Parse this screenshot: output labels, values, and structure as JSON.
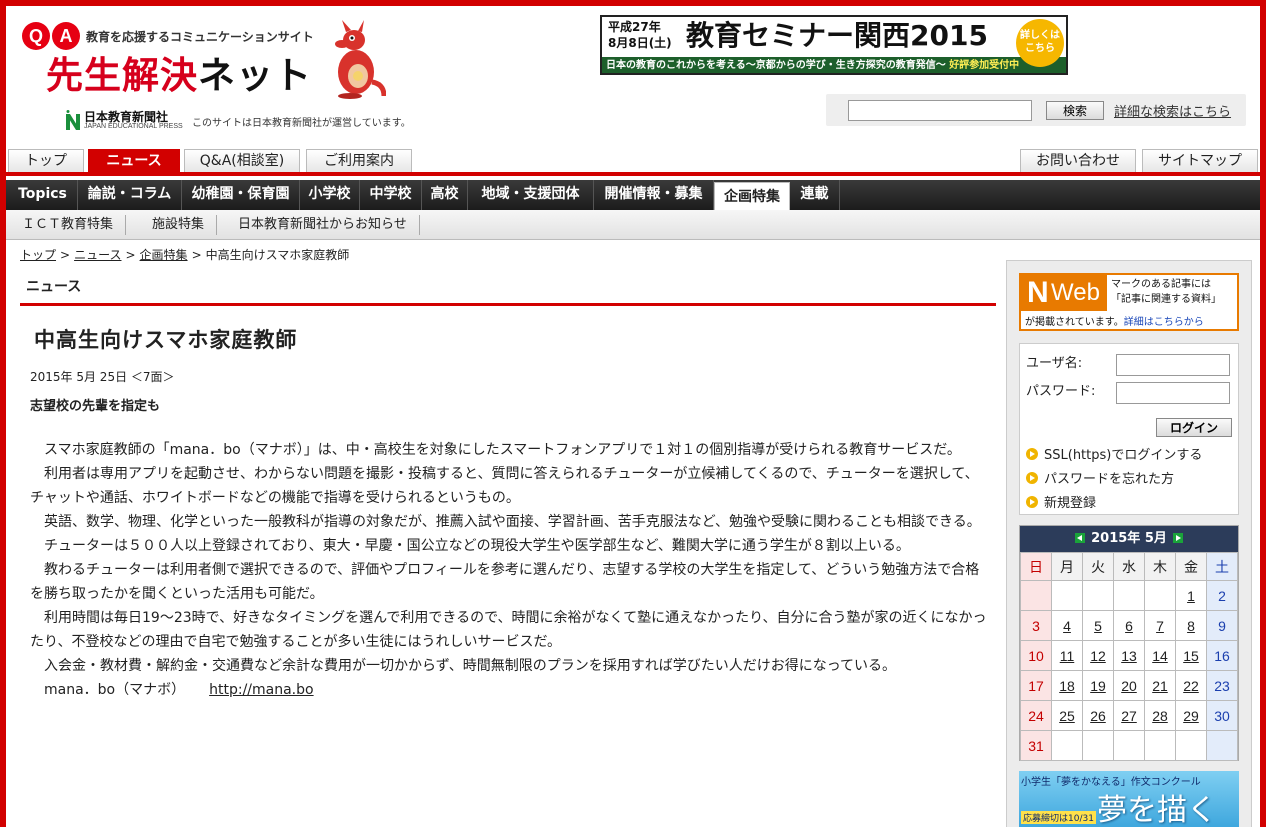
{
  "header": {
    "tagline": "教育を応援するコミュニケーションサイト",
    "qa_q": "Q",
    "qa_a": "A",
    "site_name_red": "先生解決",
    "site_name_black": "ネット",
    "publisher_name": "日本教育新聞社",
    "publisher_en": "JAPAN EDUCATIONAL PRESS",
    "publisher_note": "このサイトは日本教育新聞社が運営しています。"
  },
  "banner": {
    "date_line": "平成27年\n8月8日(土)",
    "title": "教育セミナー関西2015",
    "sub_text": "日本の教育のこれからを考える～京都からの学び・生き方探究の教育発信～",
    "sub_highlight": "好評参加受付中",
    "badge": "詳しくは\nこちら"
  },
  "search": {
    "placeholder": "",
    "button_label": "検索",
    "advanced_label": "詳細な検索はこちら"
  },
  "tabs": [
    {
      "label": "トップ"
    },
    {
      "label": "ニュース"
    },
    {
      "label": "Q&A(相談室)"
    },
    {
      "label": "ご利用案内"
    },
    {
      "label": "お問い合わせ"
    },
    {
      "label": "サイトマップ"
    }
  ],
  "categories": [
    {
      "label": "Topics"
    },
    {
      "label": "論説・コラム"
    },
    {
      "label": "幼稚園・保育園"
    },
    {
      "label": "小学校"
    },
    {
      "label": "中学校"
    },
    {
      "label": "高校"
    },
    {
      "label": "地域・支援団体"
    },
    {
      "label": "開催情報・募集"
    },
    {
      "label": "企画特集"
    },
    {
      "label": "連載"
    }
  ],
  "subcategories": [
    {
      "label": "ＩＣＴ教育特集"
    },
    {
      "label": "施設特集"
    },
    {
      "label": "日本教育新聞社からお知らせ"
    }
  ],
  "breadcrumb": {
    "items": [
      "トップ",
      "ニュース",
      "企画特集"
    ],
    "current": "中高生向けスマホ家庭教師",
    "separator": ">"
  },
  "section": {
    "title": "ニュース"
  },
  "article": {
    "title": "中高生向けスマホ家庭教師",
    "date": "2015年 5月 25日 ＜7面＞",
    "subtitle": "志望校の先輩を指定も",
    "paragraphs": [
      "スマホ家庭教師の「mana．bo（マナボ）」は、中・高校生を対象にしたスマートフォンアプリで１対１の個別指導が受けられる教育サービスだ。",
      "利用者は専用アプリを起動させ、わからない問題を撮影・投稿すると、質問に答えられるチューターが立候補してくるので、チューターを選択して、チャットや通話、ホワイトボードなどの機能で指導を受けられるというもの。",
      "英語、数学、物理、化学といった一般教科が指導の対象だが、推薦入試や面接、学習計画、苦手克服法など、勉強や受験に関わることも相談できる。",
      "チューターは５００人以上登録されており、東大・早慶・国公立などの現役大学生や医学部生など、難関大学に通う学生が８割以上いる。",
      "教わるチューターは利用者側で選択できるので、評価やプロフィールを参考に選んだり、志望する学校の大学生を指定して、どういう勉強方法で合格を勝ち取ったかを聞くといった活用も可能だ。",
      "利用時間は毎日19～23時で、好きなタイミングを選んで利用できるので、時間に余裕がなくて塾に通えなかったり、自分に合う塾が家の近くになかったり、不登校などの理由で自宅で勉強することが多い生徒にはうれしいサービスだ。",
      "入会金・教材費・解約金・交通費など余計な費用が一切かからず、時間無制限のプランを採用すれば学びたい人だけお得になっている。"
    ],
    "source_name": "mana．bo（マナボ）",
    "source_link": "http://mana.bo"
  },
  "sidebar": {
    "nweb": {
      "logo_n": "N",
      "logo_web": "Web",
      "text1": "マークのある記事には\n「記事に関連する資料」",
      "text2": "が掲載されています。",
      "link": "詳細はこちらから"
    },
    "login": {
      "user_label": "ユーザ名:",
      "password_label": "パスワード:",
      "button_label": "ログイン",
      "links": [
        "SSL(https)でログインする",
        "パスワードを忘れた方",
        "新規登録"
      ]
    },
    "calendar": {
      "month_label": "2015年 5月",
      "weekdays": [
        "日",
        "月",
        "火",
        "水",
        "木",
        "金",
        "土"
      ],
      "weeks": [
        [
          "",
          "",
          "",
          "",
          "",
          "1",
          "2"
        ],
        [
          "3",
          "4",
          "5",
          "6",
          "7",
          "8",
          "9"
        ],
        [
          "10",
          "11",
          "12",
          "13",
          "14",
          "15",
          "16"
        ],
        [
          "17",
          "18",
          "19",
          "20",
          "21",
          "22",
          "23"
        ],
        [
          "24",
          "25",
          "26",
          "27",
          "28",
          "29",
          "30"
        ],
        [
          "31",
          "",
          "",
          "",
          "",
          "",
          ""
        ]
      ],
      "linked_days": [
        "1",
        "4",
        "5",
        "6",
        "7",
        "8",
        "11",
        "12",
        "13",
        "14",
        "15",
        "18",
        "19",
        "20",
        "21",
        "22",
        "25",
        "26",
        "27",
        "28",
        "29"
      ]
    },
    "essay_banner": {
      "top_text": "小学生「夢をかなえる」作文コンクール",
      "big_text": "夢を描く",
      "small_text": "応募締切は10/31"
    }
  },
  "colors": {
    "brand_red": "#d20000",
    "nav_dark": "#2a2a2a",
    "nweb_orange": "#e87a00",
    "calendar_head": "#2c3c5a"
  }
}
